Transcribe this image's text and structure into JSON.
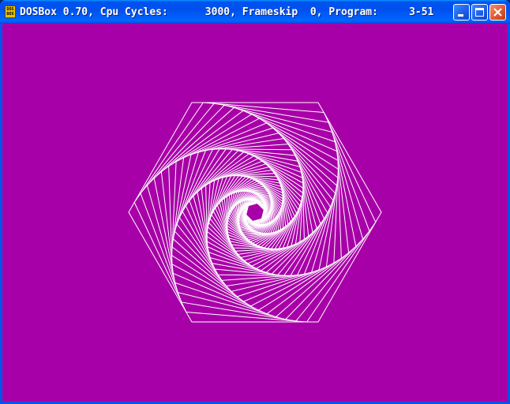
{
  "window": {
    "title": "DOSBox 0.70, Cpu Cycles:      3000, Frameskip  0, Program:     3-51",
    "icon_text_top": "DOS",
    "icon_text_bottom": "BOX",
    "icon": "dosbox-app-icon",
    "buttons": {
      "minimize": "minimize-icon",
      "maximize": "maximize-icon",
      "close": "close-icon"
    }
  },
  "canvas": {
    "background": "#a800a8",
    "line_color": "#ffffff",
    "figure": "nested rotating hexagons (spiral)"
  }
}
